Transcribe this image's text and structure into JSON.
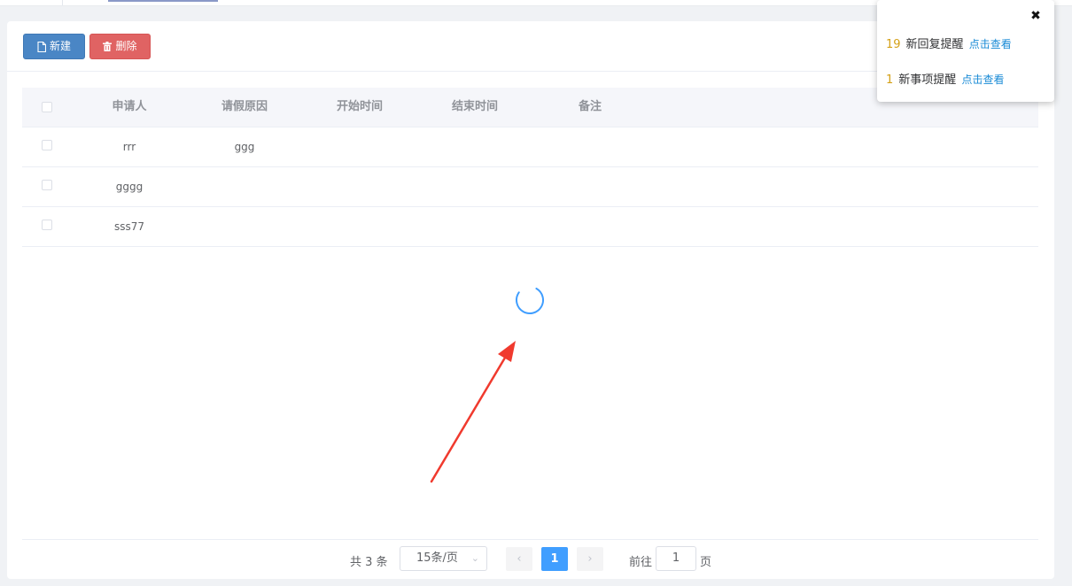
{
  "toolbar": {
    "new_label": "新建",
    "delete_label": "删除"
  },
  "table": {
    "columns": [
      "申请人",
      "请假原因",
      "开始时间",
      "结束时间",
      "备注"
    ],
    "rows": [
      {
        "applicant": "rrr",
        "reason": "ggg",
        "start": "",
        "end": "",
        "remark": ""
      },
      {
        "applicant": "gggg",
        "reason": "",
        "start": "",
        "end": "",
        "remark": ""
      },
      {
        "applicant": "sss77",
        "reason": "",
        "start": "",
        "end": "",
        "remark": ""
      }
    ]
  },
  "loading": {
    "icon": "loading-spinner-icon",
    "color": "#409eff"
  },
  "annotation": {
    "icon": "red-arrow",
    "color": "#f03a2e"
  },
  "pagination": {
    "total_text": "共 3 条",
    "page_size": "15条/页",
    "current_page": "1",
    "goto_prefix": "前往",
    "goto_value": "1",
    "goto_suffix": "页"
  },
  "notifications": {
    "items": [
      {
        "count": "19",
        "label": "新回复提醒",
        "link": "点击查看"
      },
      {
        "count": "1",
        "label": "新事项提醒",
        "link": "点击查看"
      }
    ],
    "close_icon": "close-icon"
  },
  "colors": {
    "primary": "#409eff",
    "new_button": "#4a86c5",
    "delete_button": "#e06363"
  }
}
